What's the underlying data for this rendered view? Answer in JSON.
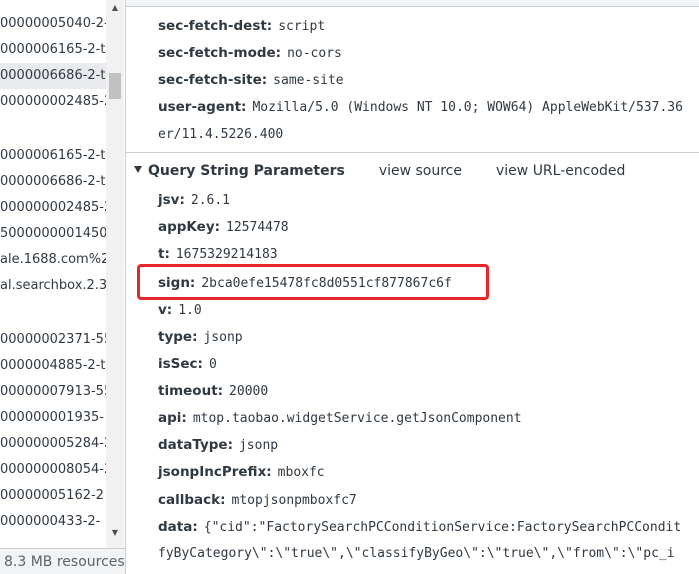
{
  "requests": [
    "00000005040-2-",
    "0000006165-2-t",
    "0000006686-2-t",
    "000000002485-2",
    "",
    "0000006165-2-t",
    "0000006686-2-t",
    "000000002485-2",
    "5000000001450-",
    "ale.1688.com%2",
    "al.searchbox.2.3",
    "",
    "00000002371-55",
    "0000004885-2-tp",
    "00000007913-55",
    "000000001935-",
    "000000005284-2",
    "000000008054-2",
    "00000005162-2",
    "0000000433-2-"
  ],
  "status": {
    "resources": "8.3 MB resources"
  },
  "headers": [
    {
      "key": "sec-fetch-dest:",
      "value": "script"
    },
    {
      "key": "sec-fetch-mode:",
      "value": "no-cors"
    },
    {
      "key": "sec-fetch-site:",
      "value": "same-site"
    },
    {
      "key": "user-agent:",
      "value": "Mozilla/5.0 (Windows NT 10.0; WOW64) AppleWebKit/537.36"
    },
    {
      "key": "",
      "value": "er/11.4.5226.400"
    }
  ],
  "query_section": {
    "title": "Query String Parameters",
    "view_source": "view source",
    "view_url_encoded": "view URL-encoded"
  },
  "params": [
    {
      "key": "jsv:",
      "value": "2.6.1"
    },
    {
      "key": "appKey:",
      "value": "12574478"
    },
    {
      "key": "t:",
      "value": "1675329214183"
    },
    {
      "key": "sign:",
      "value": "2bca0efe15478fc8d0551cf877867c6f"
    },
    {
      "key": "v:",
      "value": "1.0"
    },
    {
      "key": "type:",
      "value": "jsonp"
    },
    {
      "key": "isSec:",
      "value": "0"
    },
    {
      "key": "timeout:",
      "value": "20000"
    },
    {
      "key": "api:",
      "value": "mtop.taobao.widgetService.getJsonComponent"
    },
    {
      "key": "dataType:",
      "value": "jsonp"
    },
    {
      "key": "jsonpIncPrefix:",
      "value": "mboxfc"
    },
    {
      "key": "callback:",
      "value": "mtopjsonpmboxfc7"
    },
    {
      "key": "data:",
      "value": "{\"cid\":\"FactorySearchPCConditionService:FactorySearchPCCondit"
    },
    {
      "key": "",
      "value": "fyByCategory\\\":\\\"true\\\",\\\"classifyByGeo\\\":\\\"true\\\",\\\"from\\\":\\\"pc_i"
    }
  ]
}
